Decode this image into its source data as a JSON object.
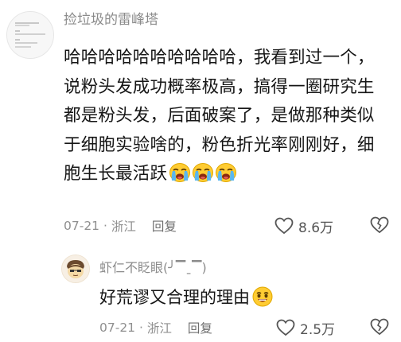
{
  "comment": {
    "username": "捡垃圾的雷峰塔",
    "text": "哈哈哈哈哈哈哈哈哈哈，我看到过一个，说粉头发成功概率极高，搞得一圈研究生都是粉头发，后面破案了，是做那种类似于细胞实验啥的，粉色折光率刚刚好，细胞生长最活跃",
    "emoji": [
      "loudly-crying-face",
      "loudly-crying-face",
      "loudly-crying-face"
    ],
    "date": "07-21",
    "location": "浙江",
    "reply_label": "回复",
    "likes": "8.6万"
  },
  "reply": {
    "username": "虾仁不眨眼(╯▔ˍ▔)",
    "text": "好荒谬又合理的理由",
    "emoji": "grinning-face",
    "date": "07-21",
    "location": "浙江",
    "reply_label": "回复",
    "likes": "2.5万"
  },
  "colors": {
    "meta": "#8f8f8f",
    "text": "#161616",
    "username": "#8b8b8b"
  }
}
